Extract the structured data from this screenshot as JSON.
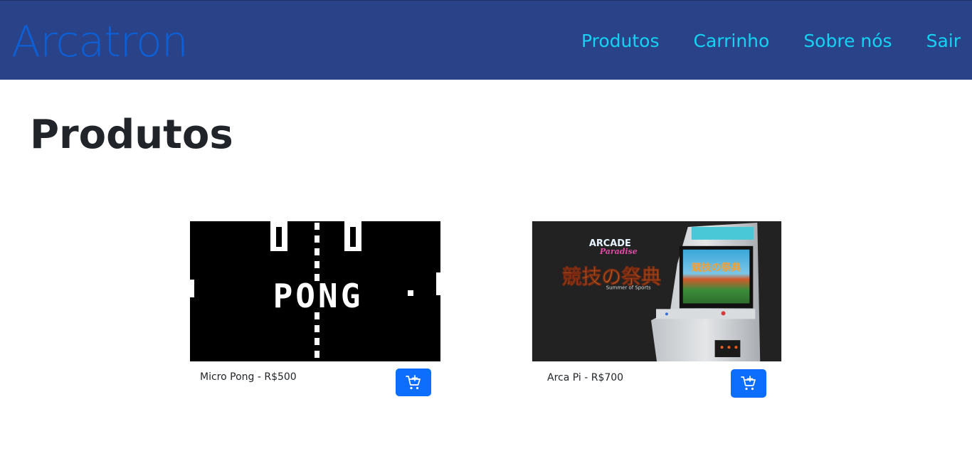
{
  "navbar": {
    "brand": "Arcatron",
    "links": [
      "Produtos",
      "Carrinho",
      "Sobre nós",
      "Sair"
    ]
  },
  "main": {
    "title": "Produtos"
  },
  "products": [
    {
      "label": "Micro Pong - R$500",
      "image_text": "PONG",
      "cart_icon": "add-to-cart-icon"
    },
    {
      "label": "Arca Pi - R$700",
      "image_logo_line1": "ARCADE",
      "image_logo_line2": "Paradise",
      "image_jp_title": "競技の祭典",
      "image_subtitle": "Summer of Sports",
      "cart_icon": "add-to-cart-icon"
    }
  ],
  "colors": {
    "navbar_bg": "#2a4288",
    "brand": "#0d5fd6",
    "nav_link": "#14d3f2",
    "button_bg": "#0d6efd"
  }
}
